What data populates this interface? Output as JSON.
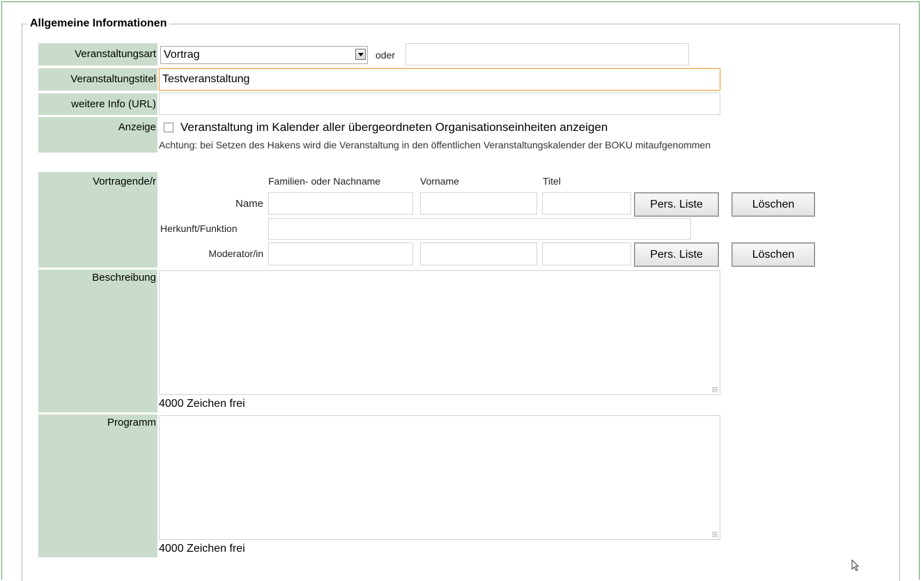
{
  "section": {
    "legend": "Allgemeine Informationen"
  },
  "labels": {
    "veranstaltungsart": "Veranstaltungsart",
    "veranstaltungstitel": "Veranstaltungstitel",
    "weitere_info": "weitere Info (URL)",
    "anzeige": "Anzeige",
    "vortragende": "Vortragende/r",
    "beschreibung": "Beschreibung",
    "programm": "Programm"
  },
  "veranstaltungsart": {
    "selected": "Vortrag",
    "oder": "oder",
    "other_value": ""
  },
  "veranstaltungstitel": {
    "value": "Testveranstaltung"
  },
  "weitere_info": {
    "value": ""
  },
  "anzeige": {
    "checkbox_label": "Veranstaltung im Kalender aller übergeordneten Organisationseinheiten anzeigen",
    "checked": false,
    "note": "Achtung: bei Setzen des Hakens wird die Veranstaltung in den öffentlichen Veranstaltungskalender der BOKU mitaufgenommen"
  },
  "vortragende": {
    "col_headers": {
      "nachname": "Familien- oder Nachname",
      "vorname": "Vorname",
      "titel": "Titel"
    },
    "name_label": "Name",
    "herkunft_label": "Herkunft/Funktion",
    "moderator_label": "Moderator/in",
    "pers_liste_label": "Pers. Liste",
    "loeschen_label": "Löschen"
  },
  "beschreibung": {
    "counter": "4000 Zeichen frei"
  },
  "programm": {
    "counter": "4000 Zeichen frei"
  }
}
